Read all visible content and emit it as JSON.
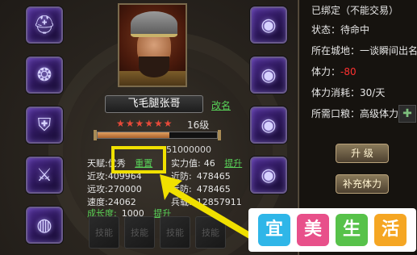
{
  "character": {
    "name": "飞毛腿张哥",
    "rename": "改名",
    "stars": "★★★★★★",
    "level": "16级",
    "exp_overlay": "51000000",
    "exp_fraction": 0.6
  },
  "stats": {
    "talent_label": "天赋:",
    "talent_value": "优秀",
    "talent_reset": "重置",
    "power_label": "实力值:",
    "power_value": "46",
    "power_up": "提升",
    "ranged_atk_label": "近攻:",
    "ranged_atk_value": "409964",
    "melee_def_label": "近防:",
    "melee_def_value": "478465",
    "far_atk_label": "远攻:",
    "far_atk_value": "270000",
    "far_def_label": "远防:",
    "far_def_value": "478465",
    "speed_label": "速度:",
    "speed_value": "24062",
    "hp_label": "兵载:",
    "hp_value": "12857911",
    "growth_label": "成长度:",
    "growth_value": "1000",
    "growth_up": "提升"
  },
  "empty_slots": [
    "技能",
    "技能",
    "技能",
    "技能"
  ],
  "right": {
    "bound": "已绑定（不能交易）",
    "status": "状态：待命中",
    "city_label": "所在城地：",
    "city_value": "一谈瞬间出名",
    "stamina_label": "体力：",
    "stamina_value": "-80",
    "consume": "体力消耗：30/天",
    "need_label": "所需口粮：",
    "need_value": "高级体力药",
    "upgrade_btn": "升 级",
    "refill_btn": "补充体力"
  },
  "watermark": [
    "宜",
    "美",
    "生",
    "活"
  ],
  "colors": {
    "highlight": "#f0e000",
    "link_green": "#58d058",
    "stamina_red": "#ff3030"
  }
}
